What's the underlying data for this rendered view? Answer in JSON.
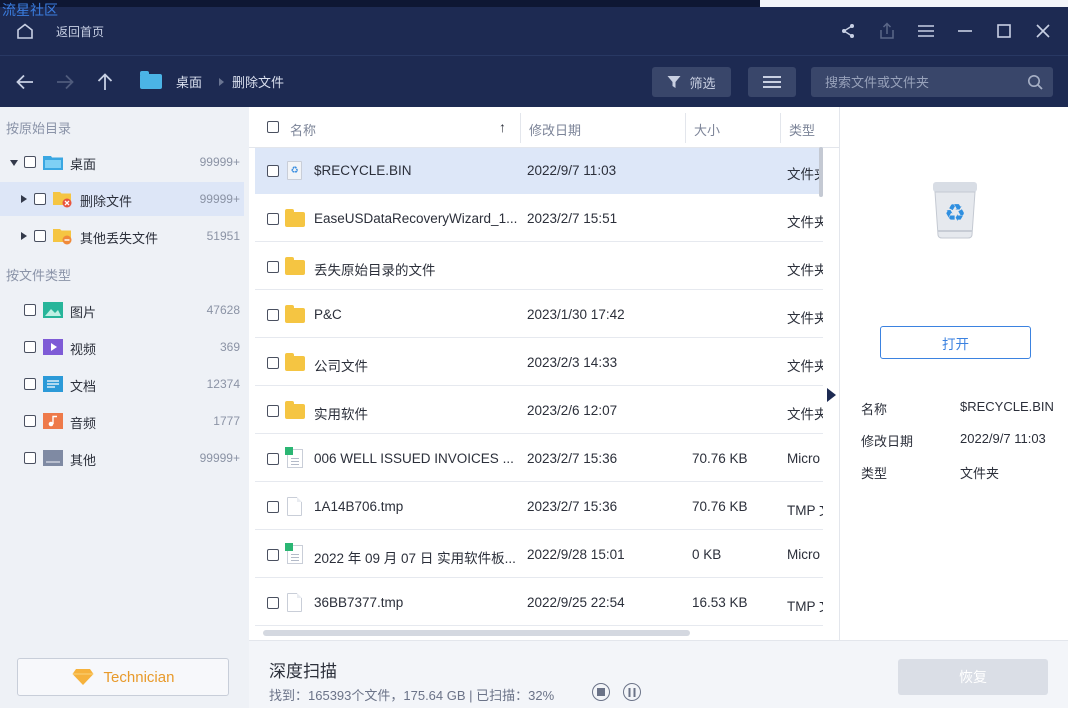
{
  "watermark": "流星社区",
  "topbar": {
    "home_label": "返回首页"
  },
  "nav": {
    "breadcrumb": [
      "桌面",
      "删除文件"
    ],
    "filter_label": "筛选",
    "search_placeholder": "搜索文件或文件夹"
  },
  "sidebar": {
    "section_path": "按原始目录",
    "tree": [
      {
        "label": "桌面",
        "count": "99999+"
      },
      {
        "label": "删除文件",
        "count": "99999+"
      },
      {
        "label": "其他丢失文件",
        "count": "51951"
      }
    ],
    "section_type": "按文件类型",
    "types": [
      {
        "label": "图片",
        "count": "47628"
      },
      {
        "label": "视频",
        "count": "369"
      },
      {
        "label": "文档",
        "count": "12374"
      },
      {
        "label": "音频",
        "count": "1777"
      },
      {
        "label": "其他",
        "count": "99999+"
      }
    ],
    "technician_label": "Technician"
  },
  "list": {
    "columns": {
      "name": "名称",
      "date": "修改日期",
      "size": "大小",
      "type": "类型"
    },
    "sort_indicator": "↑",
    "rows": [
      {
        "icon": "recycle-bin-icon",
        "name": "$RECYCLE.BIN",
        "date": "2022/9/7 11:03",
        "size": "",
        "type": "文件夹"
      },
      {
        "icon": "folder-icon",
        "name": "EaseUSDataRecoveryWizard_1...",
        "date": "2023/2/7 15:51",
        "size": "",
        "type": "文件夹"
      },
      {
        "icon": "folder-icon",
        "name": "丢失原始目录的文件",
        "date": "",
        "size": "",
        "type": "文件夹"
      },
      {
        "icon": "folder-icon",
        "name": "P&C",
        "date": "2023/1/30 17:42",
        "size": "",
        "type": "文件夹"
      },
      {
        "icon": "folder-icon",
        "name": "公司文件",
        "date": "2023/2/3 14:33",
        "size": "",
        "type": "文件夹"
      },
      {
        "icon": "folder-icon",
        "name": "实用软件",
        "date": "2023/2/6 12:07",
        "size": "",
        "type": "文件夹"
      },
      {
        "icon": "spreadsheet-icon",
        "name": "006  WELL ISSUED INVOICES ...",
        "date": "2023/2/7 15:36",
        "size": "70.76 KB",
        "type": "Micro"
      },
      {
        "icon": "file-icon",
        "name": "1A14B706.tmp",
        "date": "2023/2/7 15:36",
        "size": "70.76 KB",
        "type": "TMP 文"
      },
      {
        "icon": "spreadsheet-icon",
        "name": "2022 年 09 月 07 日 实用软件板...",
        "date": "2022/9/28 15:01",
        "size": "0 KB",
        "type": "Micro"
      },
      {
        "icon": "file-icon",
        "name": "36BB7377.tmp",
        "date": "2022/9/25 22:54",
        "size": "16.53 KB",
        "type": "TMP 文"
      }
    ]
  },
  "preview": {
    "open_label": "打开",
    "props": [
      {
        "key": "名称",
        "value": "$RECYCLE.BIN"
      },
      {
        "key": "修改日期",
        "value": "2022/9/7 11:03"
      },
      {
        "key": "类型",
        "value": "文件夹"
      }
    ]
  },
  "bottom": {
    "title": "深度扫描",
    "status": "找到：165393个文件，175.64 GB | 已扫描：32%",
    "scan_progress_percent": 32,
    "recover_label": "恢复"
  }
}
